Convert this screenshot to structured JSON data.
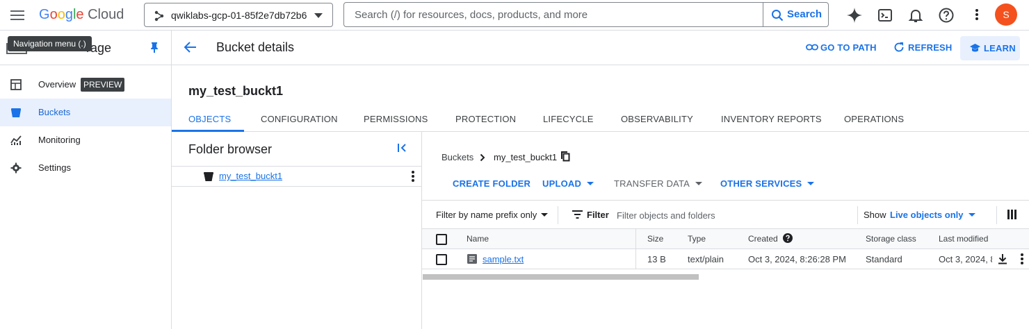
{
  "header": {
    "menu_icon": "hamburger-menu-icon",
    "logo": "Google Cloud",
    "project_name": "qwiklabs-gcp-01-85f2e7db72b6",
    "search_placeholder": "Search (/) for resources, docs, products, and more",
    "search_button": "Search",
    "icons": [
      "gemini-sparkle-icon",
      "cloud-shell-icon",
      "notifications-bell-icon",
      "help-icon",
      "more-vert-icon"
    ],
    "avatar_letter": "S",
    "avatar_color": "#f4511e"
  },
  "tooltip": "Navigation menu (.)",
  "sidebar": {
    "product_title": "Cloud Storage",
    "items": [
      {
        "label": "Overview",
        "icon": "overview-icon",
        "badge": "PREVIEW",
        "active": false
      },
      {
        "label": "Buckets",
        "icon": "bucket-icon",
        "active": true
      },
      {
        "label": "Monitoring",
        "icon": "monitoring-chart-icon",
        "active": false
      },
      {
        "label": "Settings",
        "icon": "gear-icon",
        "active": false
      }
    ]
  },
  "page": {
    "title": "Bucket details",
    "actions": [
      "GO TO PATH",
      "REFRESH",
      "LEARN"
    ],
    "bucket_name": "my_test_buckt1"
  },
  "tabs": [
    "OBJECTS",
    "CONFIGURATION",
    "PERMISSIONS",
    "PROTECTION",
    "LIFECYCLE",
    "OBSERVABILITY",
    "INVENTORY REPORTS",
    "OPERATIONS"
  ],
  "folder_browser": {
    "title": "Folder browser",
    "item": "my_test_buckt1"
  },
  "breadcrumb": [
    "Buckets",
    "my_test_buckt1"
  ],
  "object_actions": [
    "CREATE FOLDER",
    "UPLOAD",
    "TRANSFER DATA",
    "OTHER SERVICES"
  ],
  "filter": {
    "mode": "Filter by name prefix only",
    "label": "Filter",
    "placeholder": "Filter objects and folders",
    "show_label": "Show",
    "show_value": "Live objects only"
  },
  "table": {
    "columns": [
      "Name",
      "Size",
      "Type",
      "Created",
      "Storage class",
      "Last modified"
    ],
    "rows": [
      {
        "name": "sample.txt",
        "size": "13 B",
        "type": "text/plain",
        "created": "Oct 3, 2024, 8:26:28 PM",
        "storage_class": "Standard",
        "last_modified": "Oct 3, 2024, 8"
      }
    ]
  },
  "colors": {
    "accent": "#1a73e8",
    "active_bg": "#e8f0fe"
  }
}
